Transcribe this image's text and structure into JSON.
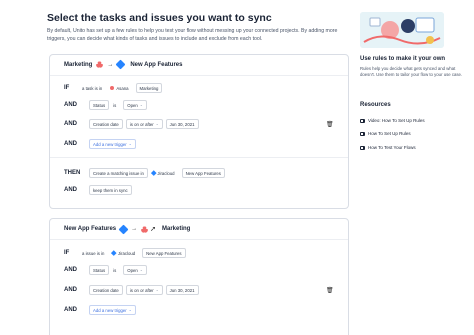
{
  "header": {
    "title": "Select the tasks and issues you want to sync",
    "description": "By default, Unito has set up a few rules to help you test your flow without messing up your connected projects. By adding more triggers, you can decide what kinds of tasks and issues to include and exclude from each tool."
  },
  "flow1": {
    "source": "Marketing",
    "target": "New App Features",
    "arrow": "→",
    "if_kw": "IF",
    "if_subject": "a task is in",
    "if_app": "Asana",
    "if_value": "Marketing",
    "and_kw": "AND",
    "status_field": "Status",
    "status_op": "is",
    "status_value": "Open",
    "date_field": "Creation date",
    "date_op": "is on or after",
    "date_value": "Jun 30, 2021",
    "add_trigger": "Add a new trigger",
    "then_kw": "THEN",
    "then_action": "Create a matching issue in",
    "then_app": "Jiracloud",
    "then_value": "New App Features",
    "keep_sync": "keep them in sync",
    "caret": "⌄",
    "trash": "🗑"
  },
  "flow2": {
    "source": "New App Features",
    "target": "Marketing",
    "arrow": "→",
    "if_kw": "IF",
    "if_subject": "a issue is in",
    "if_app": "Jiracloud",
    "if_value": "New App Features",
    "and_kw": "AND",
    "status_field": "Status",
    "status_op": "is",
    "status_value": "Open",
    "date_field": "Creation date",
    "date_op": "is on or after",
    "date_value": "Jun 30, 2021",
    "add_trigger": "Add a new trigger",
    "caret": "⌄",
    "trash": "🗑"
  },
  "sidebar": {
    "rules_title": "Use rules to make it your own",
    "rules_text": "Rules help you decide what gets synced and what doesn't. Use them to tailor your flow to your use case.",
    "resources_title": "Resources",
    "links": [
      "Video: How To Set Up Rules",
      "How To Set Up Rules",
      "How To Test Your Flows"
    ]
  },
  "colors": {
    "accent": "#3b6fe0",
    "asana": "#f06a6a",
    "jira": "#2684ff"
  }
}
